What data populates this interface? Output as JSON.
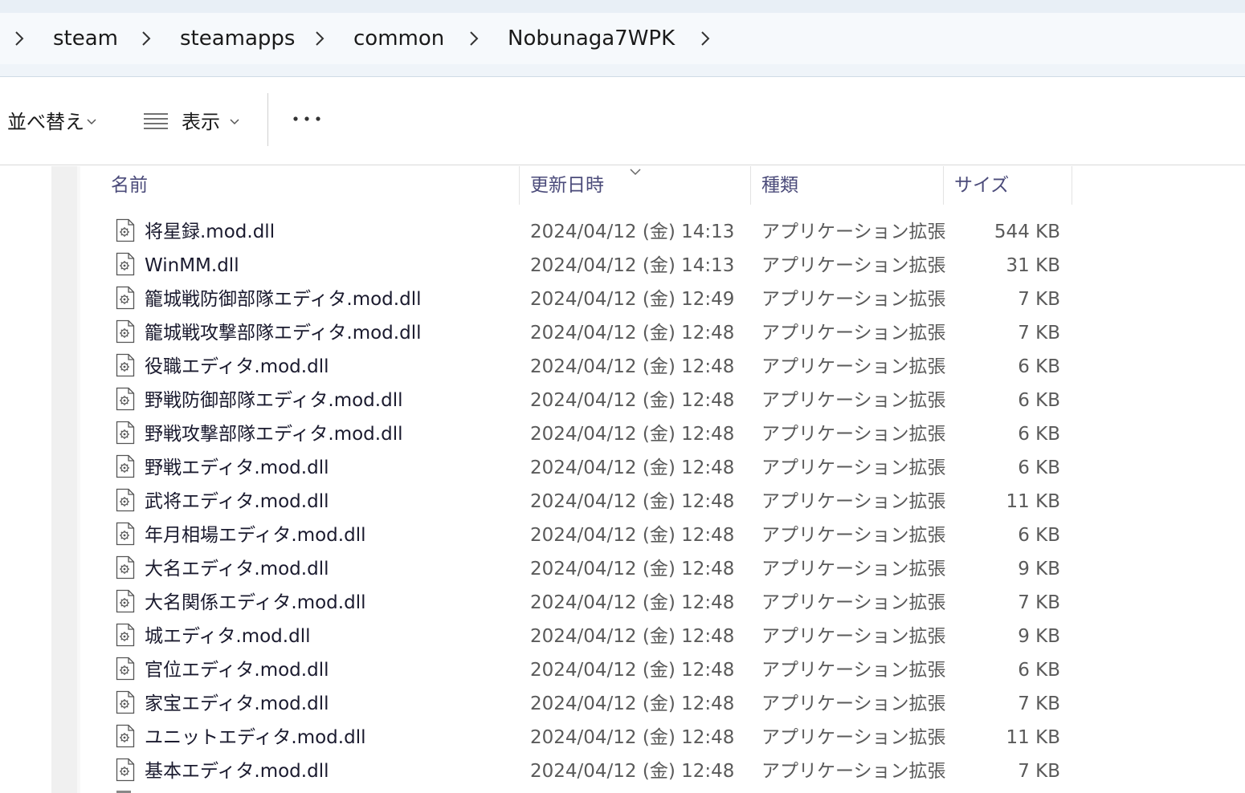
{
  "breadcrumb": {
    "items": [
      {
        "label": "steam"
      },
      {
        "label": "steamapps"
      },
      {
        "label": "common"
      },
      {
        "label": "Nobunaga7WPK"
      }
    ]
  },
  "toolbar": {
    "sort_label": "並べ替え",
    "view_label": "表示"
  },
  "columns": {
    "name": "名前",
    "date": "更新日時",
    "type": "種類",
    "size": "サイズ"
  },
  "files": [
    {
      "name": "将星録.mod.dll",
      "date": "2024/04/12 (金) 14:13",
      "type": "アプリケーション拡張",
      "size": "544 KB"
    },
    {
      "name": "WinMM.dll",
      "date": "2024/04/12 (金) 14:13",
      "type": "アプリケーション拡張",
      "size": "31 KB"
    },
    {
      "name": "籠城戦防御部隊エディタ.mod.dll",
      "date": "2024/04/12 (金) 12:49",
      "type": "アプリケーション拡張",
      "size": "7 KB"
    },
    {
      "name": "籠城戦攻撃部隊エディタ.mod.dll",
      "date": "2024/04/12 (金) 12:48",
      "type": "アプリケーション拡張",
      "size": "7 KB"
    },
    {
      "name": "役職エディタ.mod.dll",
      "date": "2024/04/12 (金) 12:48",
      "type": "アプリケーション拡張",
      "size": "6 KB"
    },
    {
      "name": "野戦防御部隊エディタ.mod.dll",
      "date": "2024/04/12 (金) 12:48",
      "type": "アプリケーション拡張",
      "size": "6 KB"
    },
    {
      "name": "野戦攻撃部隊エディタ.mod.dll",
      "date": "2024/04/12 (金) 12:48",
      "type": "アプリケーション拡張",
      "size": "6 KB"
    },
    {
      "name": "野戦エディタ.mod.dll",
      "date": "2024/04/12 (金) 12:48",
      "type": "アプリケーション拡張",
      "size": "6 KB"
    },
    {
      "name": "武将エディタ.mod.dll",
      "date": "2024/04/12 (金) 12:48",
      "type": "アプリケーション拡張",
      "size": "11 KB"
    },
    {
      "name": "年月相場エディタ.mod.dll",
      "date": "2024/04/12 (金) 12:48",
      "type": "アプリケーション拡張",
      "size": "6 KB"
    },
    {
      "name": "大名エディタ.mod.dll",
      "date": "2024/04/12 (金) 12:48",
      "type": "アプリケーション拡張",
      "size": "9 KB"
    },
    {
      "name": "大名関係エディタ.mod.dll",
      "date": "2024/04/12 (金) 12:48",
      "type": "アプリケーション拡張",
      "size": "7 KB"
    },
    {
      "name": "城エディタ.mod.dll",
      "date": "2024/04/12 (金) 12:48",
      "type": "アプリケーション拡張",
      "size": "9 KB"
    },
    {
      "name": "官位エディタ.mod.dll",
      "date": "2024/04/12 (金) 12:48",
      "type": "アプリケーション拡張",
      "size": "6 KB"
    },
    {
      "name": "家宝エディタ.mod.dll",
      "date": "2024/04/12 (金) 12:48",
      "type": "アプリケーション拡張",
      "size": "7 KB"
    },
    {
      "name": "ユニットエディタ.mod.dll",
      "date": "2024/04/12 (金) 12:48",
      "type": "アプリケーション拡張",
      "size": "11 KB"
    },
    {
      "name": "基本エディタ.mod.dll",
      "date": "2024/04/12 (金) 12:48",
      "type": "アプリケーション拡張",
      "size": "7 KB"
    }
  ],
  "icons": {
    "breadcrumb_separator": "chevron-right-icon",
    "file": "dll-file-icon",
    "sort_indicator": "chevron-down-icon"
  }
}
